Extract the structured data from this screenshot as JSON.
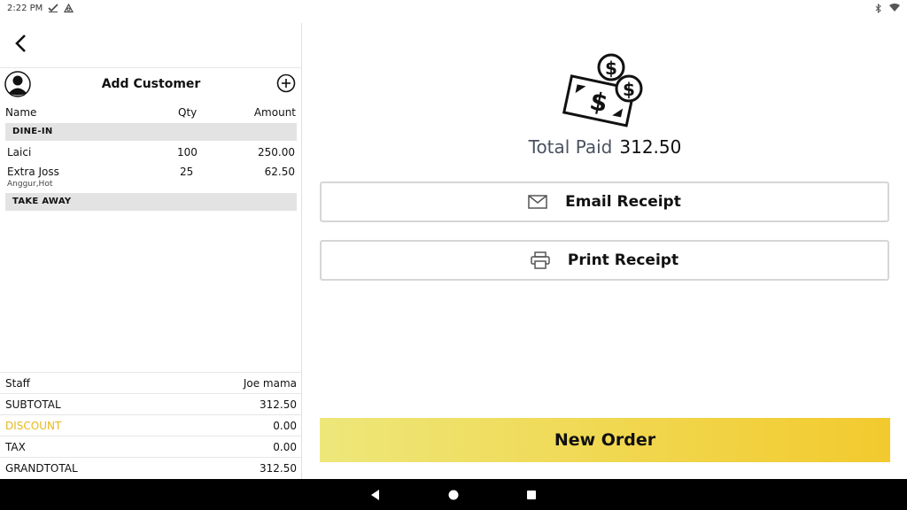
{
  "status": {
    "time": "2:22 PM"
  },
  "header": {
    "add_customer": "Add Customer"
  },
  "columns": {
    "name": "Name",
    "qty": "Qty",
    "amount": "Amount"
  },
  "sections": [
    {
      "label": "DINE-IN"
    },
    {
      "label": "TAKE AWAY"
    }
  ],
  "items": [
    {
      "name": "Laici",
      "qty": "100",
      "amount": "250.00",
      "note": ""
    },
    {
      "name": "Extra Joss",
      "qty": "25",
      "amount": "62.50",
      "note": "Anggur,Hot"
    }
  ],
  "summary": {
    "staff_label": "Staff",
    "staff_value": "Joe mama",
    "subtotal_label": "SUBTOTAL",
    "subtotal_value": "312.50",
    "discount_label": "DISCOUNT",
    "discount_value": "0.00",
    "tax_label": "TAX",
    "tax_value": "0.00",
    "grandtotal_label": "GRANDTOTAL",
    "grandtotal_value": "312.50"
  },
  "payment": {
    "total_paid_label": "Total Paid",
    "total_paid_value": "312.50"
  },
  "actions": {
    "email_receipt": "Email Receipt",
    "print_receipt": "Print Receipt",
    "new_order": "New Order"
  },
  "icons": {
    "back": "chevron-left-icon",
    "avatar": "person-icon",
    "add": "plus-circle-icon",
    "money": "money-icon",
    "email": "envelope-icon",
    "print": "printer-icon"
  },
  "colors": {
    "discount": "#e8b81a",
    "new_order_start": "#ede77a",
    "new_order_end": "#f2ca2e",
    "total_paid_label": "#4a5261"
  }
}
